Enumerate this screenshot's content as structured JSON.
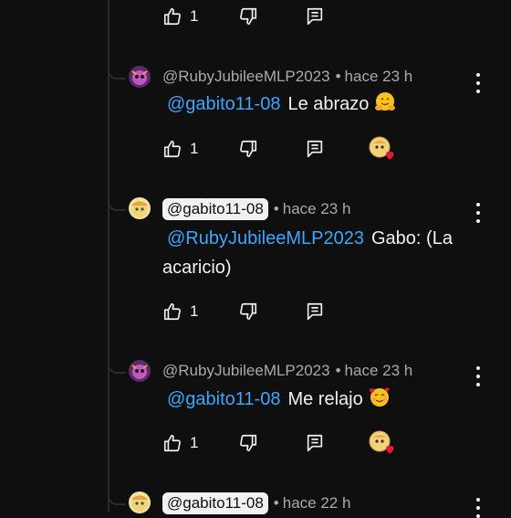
{
  "colors": {
    "background": "#0f0f0f",
    "text": "#f1f1f1",
    "secondary_text": "#aaaaaa",
    "mention": "#3ea6ff",
    "thread_line": "#2b2b2b",
    "handle_chip_bg": "#f1f1f1"
  },
  "top_actions": {
    "like_count": "1",
    "icons": [
      "thumbs-up-icon",
      "thumbs-down-icon",
      "reply-icon"
    ]
  },
  "replies": [
    {
      "author": "@RubyJubileeMLP2023",
      "separator": "•",
      "time": "hace 23 h",
      "mention": "@gabito11-08",
      "text": "Le abrazo",
      "emoji": "hugging-face-emoji",
      "like_count": "1",
      "creator_heart": true
    },
    {
      "author": "@gabito11-08",
      "separator": "•",
      "time": "hace 23 h",
      "mention": "@RubyJubileeMLP2023",
      "text": "Gabo: (La acaricio)",
      "like_count": "1",
      "creator_heart": false
    },
    {
      "author": "@RubyJubileeMLP2023",
      "separator": "•",
      "time": "hace 23 h",
      "mention": "@gabito11-08",
      "text": "Me relajo",
      "emoji": "smiling-face-with-hearts-emoji",
      "like_count": "1",
      "creator_heart": true
    },
    {
      "author": "@gabito11-08",
      "separator": "•",
      "time": "hace 22 h"
    }
  ]
}
